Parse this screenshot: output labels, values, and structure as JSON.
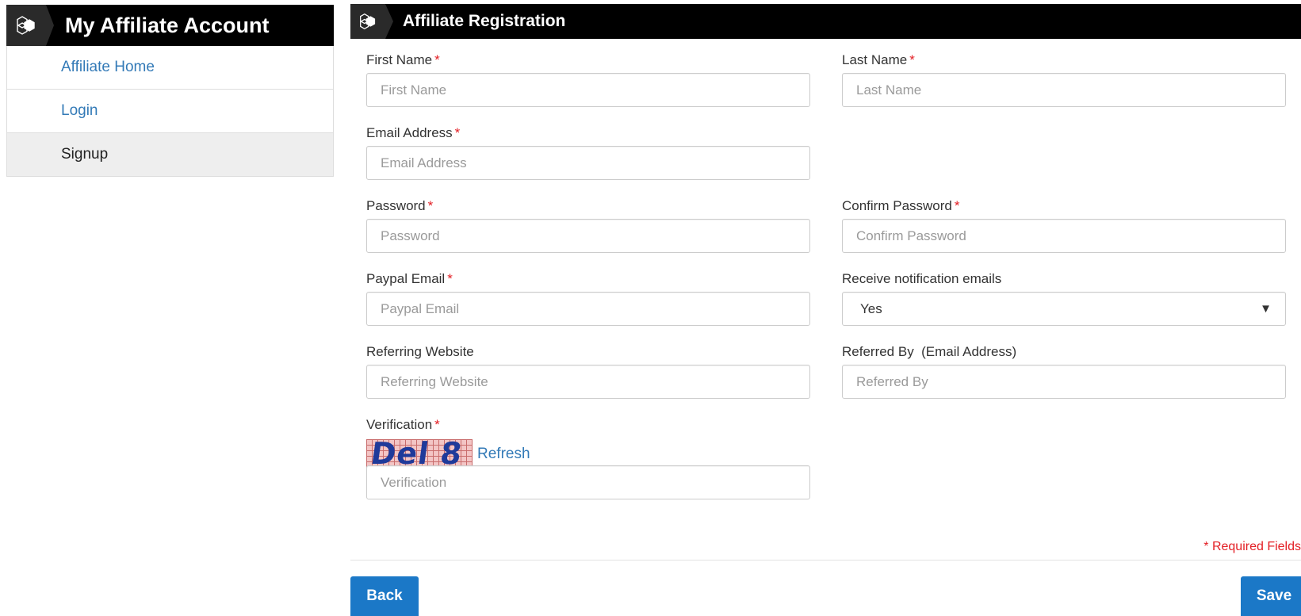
{
  "sidebar": {
    "title": "My Affiliate Account",
    "items": [
      {
        "label": "Affiliate Home"
      },
      {
        "label": "Login"
      },
      {
        "label": "Signup"
      }
    ]
  },
  "main": {
    "title": "Affiliate Registration",
    "fields": {
      "first_name": {
        "label": "First Name",
        "required": "*",
        "placeholder": "First Name"
      },
      "last_name": {
        "label": "Last Name",
        "required": "*",
        "placeholder": "Last Name"
      },
      "email": {
        "label": "Email Address",
        "required": "*",
        "placeholder": "Email Address"
      },
      "password": {
        "label": "Password",
        "required": "*",
        "placeholder": "Password"
      },
      "confirm_password": {
        "label": "Confirm Password",
        "required": "*",
        "placeholder": "Confirm Password"
      },
      "paypal_email": {
        "label": "Paypal Email",
        "required": "*",
        "placeholder": "Paypal Email"
      },
      "notifications": {
        "label": "Receive notification emails",
        "value": "Yes"
      },
      "referring_website": {
        "label": "Referring Website",
        "placeholder": "Referring Website"
      },
      "referred_by": {
        "label": "Referred By  (Email Address)",
        "placeholder": "Referred By"
      },
      "verification": {
        "label": "Verification",
        "required": "*",
        "placeholder": "Verification",
        "captcha_text": "Del 8",
        "refresh_label": "Refresh"
      }
    },
    "required_note": "* Required Fields",
    "buttons": {
      "back": "Back",
      "save": "Save"
    }
  },
  "colors": {
    "header_bg": "#000000",
    "link": "#337ab7",
    "required": "#e31e24",
    "button": "#1b78c7"
  },
  "icons": {
    "header": "hexagon-logo-icon",
    "select": "caret-down-icon"
  }
}
